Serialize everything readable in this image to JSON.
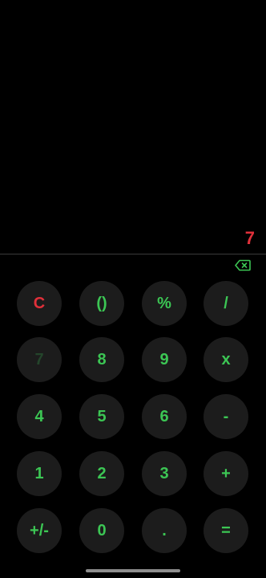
{
  "display": {
    "value": "7"
  },
  "backspace": {
    "icon": "backspace-icon",
    "color": "#3cc654"
  },
  "colors": {
    "background": "#000000",
    "key_background": "#1c1c1c",
    "accent": "#3cc654",
    "clear": "#e0303a",
    "faded_key": "#24452b",
    "divider": "#3a3a3a"
  },
  "keypad": {
    "rows": [
      [
        {
          "label": "C",
          "name": "clear-button",
          "style": "clear"
        },
        {
          "label": "()",
          "name": "parentheses-button",
          "style": "normal"
        },
        {
          "label": "%",
          "name": "percent-button",
          "style": "normal"
        },
        {
          "label": "/",
          "name": "divide-button",
          "style": "normal"
        }
      ],
      [
        {
          "label": "7",
          "name": "digit-7-button",
          "style": "faded"
        },
        {
          "label": "8",
          "name": "digit-8-button",
          "style": "normal"
        },
        {
          "label": "9",
          "name": "digit-9-button",
          "style": "normal"
        },
        {
          "label": "x",
          "name": "multiply-button",
          "style": "normal"
        }
      ],
      [
        {
          "label": "4",
          "name": "digit-4-button",
          "style": "normal"
        },
        {
          "label": "5",
          "name": "digit-5-button",
          "style": "normal"
        },
        {
          "label": "6",
          "name": "digit-6-button",
          "style": "normal"
        },
        {
          "label": "-",
          "name": "subtract-button",
          "style": "normal"
        }
      ],
      [
        {
          "label": "1",
          "name": "digit-1-button",
          "style": "normal"
        },
        {
          "label": "2",
          "name": "digit-2-button",
          "style": "normal"
        },
        {
          "label": "3",
          "name": "digit-3-button",
          "style": "normal"
        },
        {
          "label": "+",
          "name": "add-button",
          "style": "normal"
        }
      ],
      [
        {
          "label": "+/-",
          "name": "sign-toggle-button",
          "style": "normal"
        },
        {
          "label": "0",
          "name": "digit-0-button",
          "style": "normal"
        },
        {
          "label": ".",
          "name": "decimal-button",
          "style": "normal"
        },
        {
          "label": "=",
          "name": "equals-button",
          "style": "normal"
        }
      ]
    ]
  }
}
